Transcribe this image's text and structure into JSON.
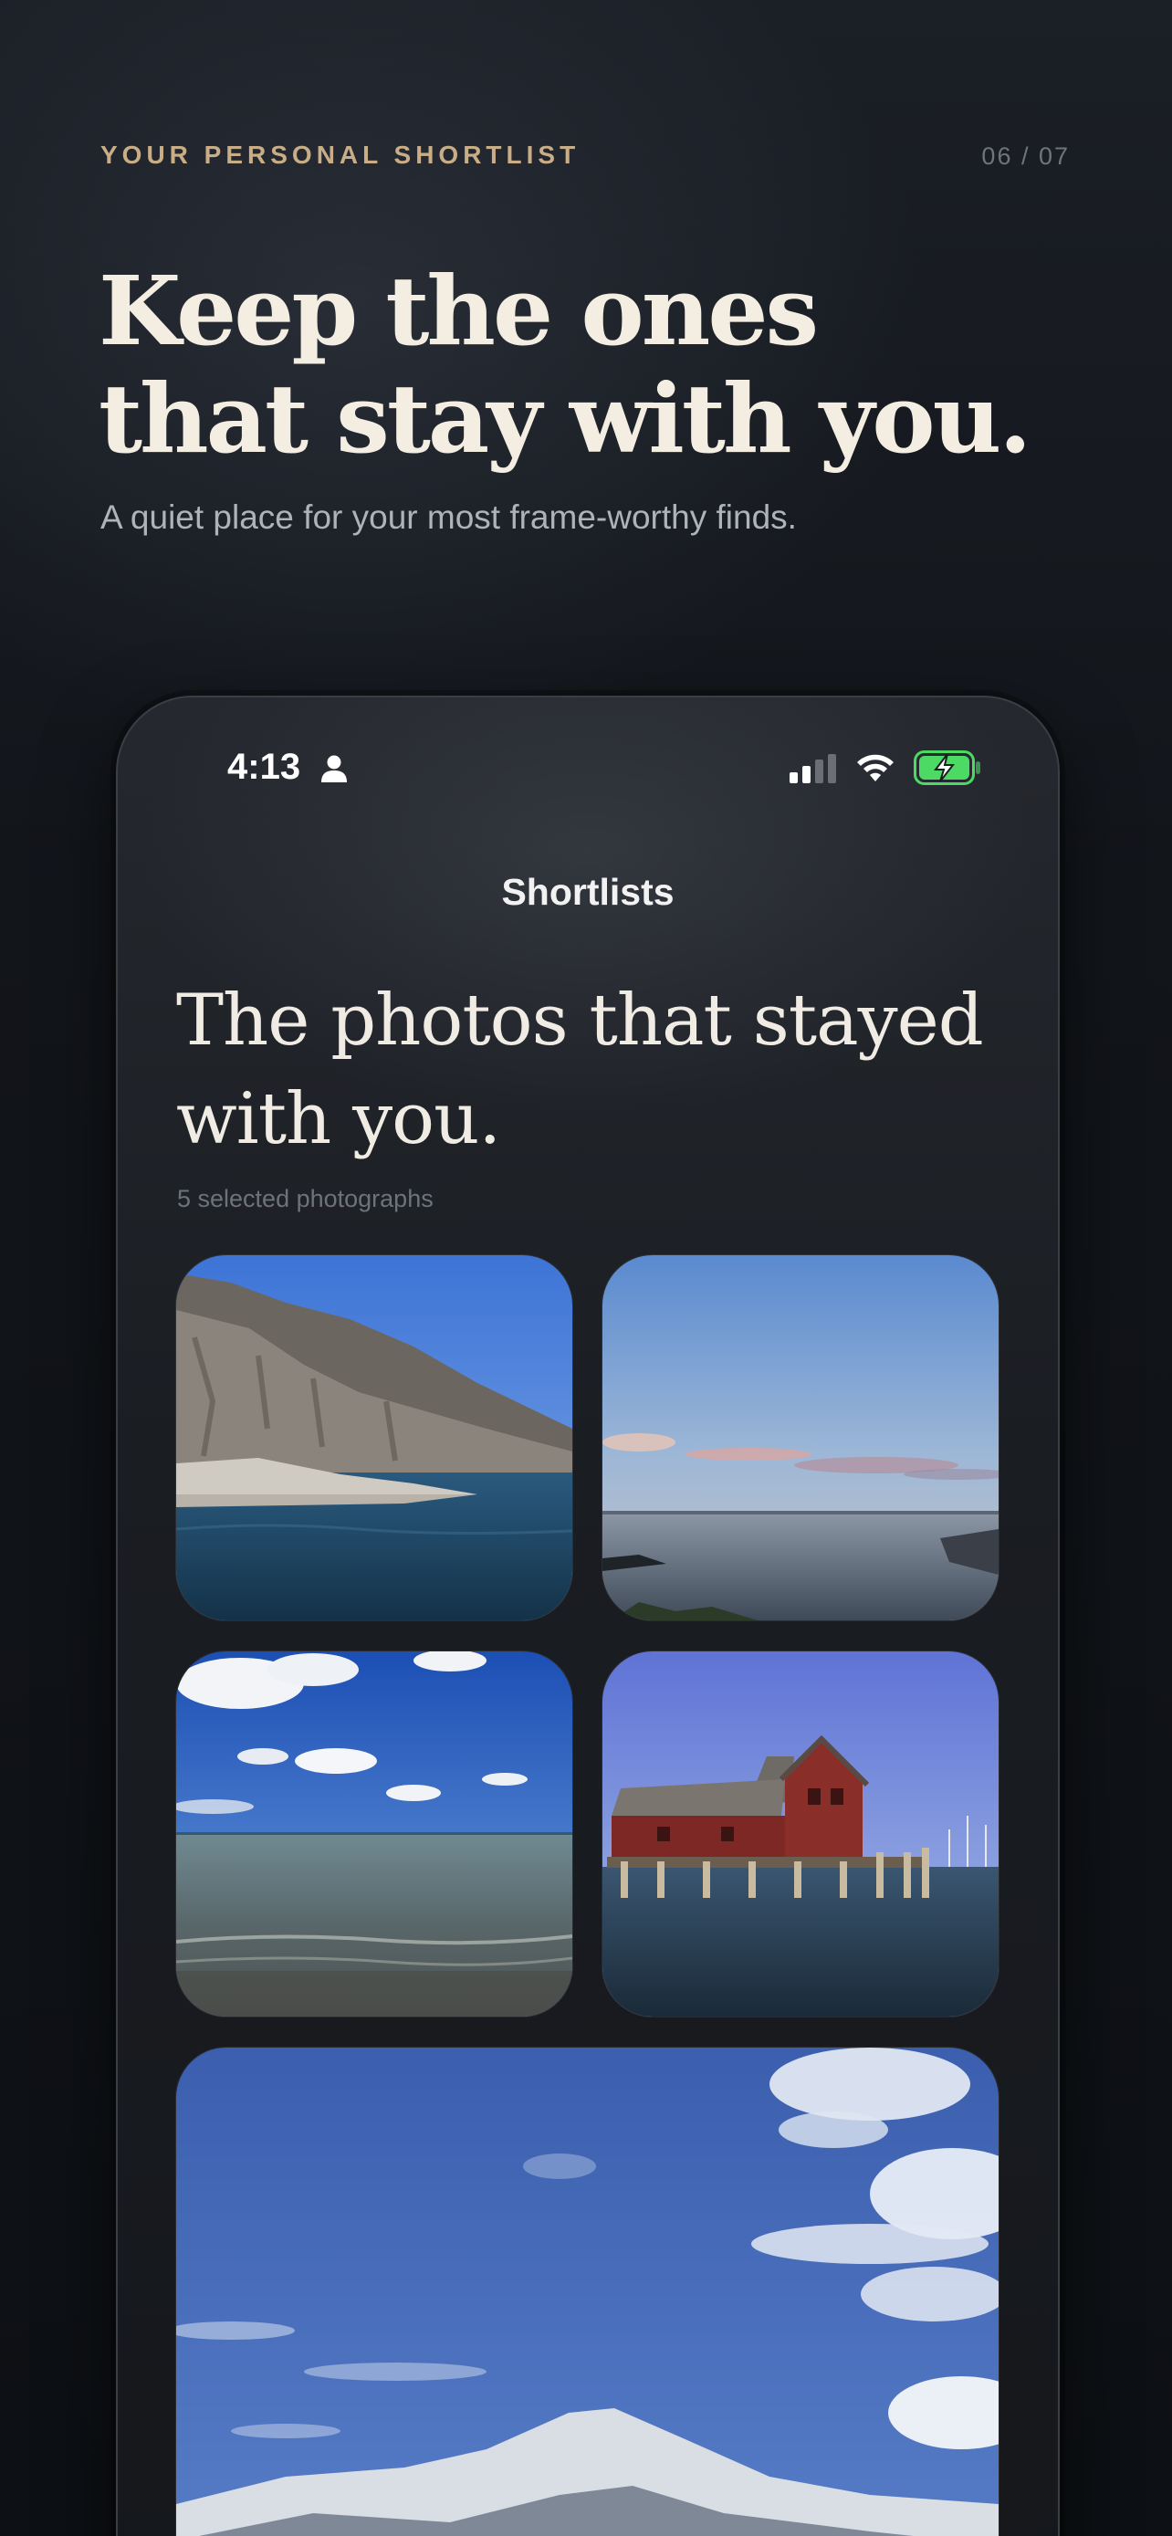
{
  "header": {
    "eyebrow": "YOUR PERSONAL SHORTLIST",
    "pager": "06 / 07",
    "title_line1": "Keep the ones",
    "title_line2": "that stay with you.",
    "subtitle": "A quiet place for your most frame-worthy finds."
  },
  "phone": {
    "status_bar": {
      "time": "4:13",
      "icons": [
        "person-icon",
        "cellular-signal-icon",
        "wifi-icon",
        "battery-charging-icon"
      ],
      "battery_color": "#4cd964"
    },
    "nav_title": "Shortlists",
    "screen_title_line1": "The photos that stayed",
    "screen_title_line2": "with you.",
    "count_label": "5 selected photographs",
    "photos": [
      {
        "subject": "rocky coastal cliff with blue sea"
      },
      {
        "subject": "calm bay at dusk with pastel clouds and pier"
      },
      {
        "subject": "beach shoreline under blue sky with puffy clouds"
      },
      {
        "subject": "red wooden fishing shack on pilings over harbor"
      },
      {
        "subject": "blue sky with wispy clouds over snowy mountain"
      }
    ]
  },
  "colors": {
    "accent_gold": "#c9ad87",
    "title_cream": "#f3ede2",
    "background": "#12151a"
  }
}
